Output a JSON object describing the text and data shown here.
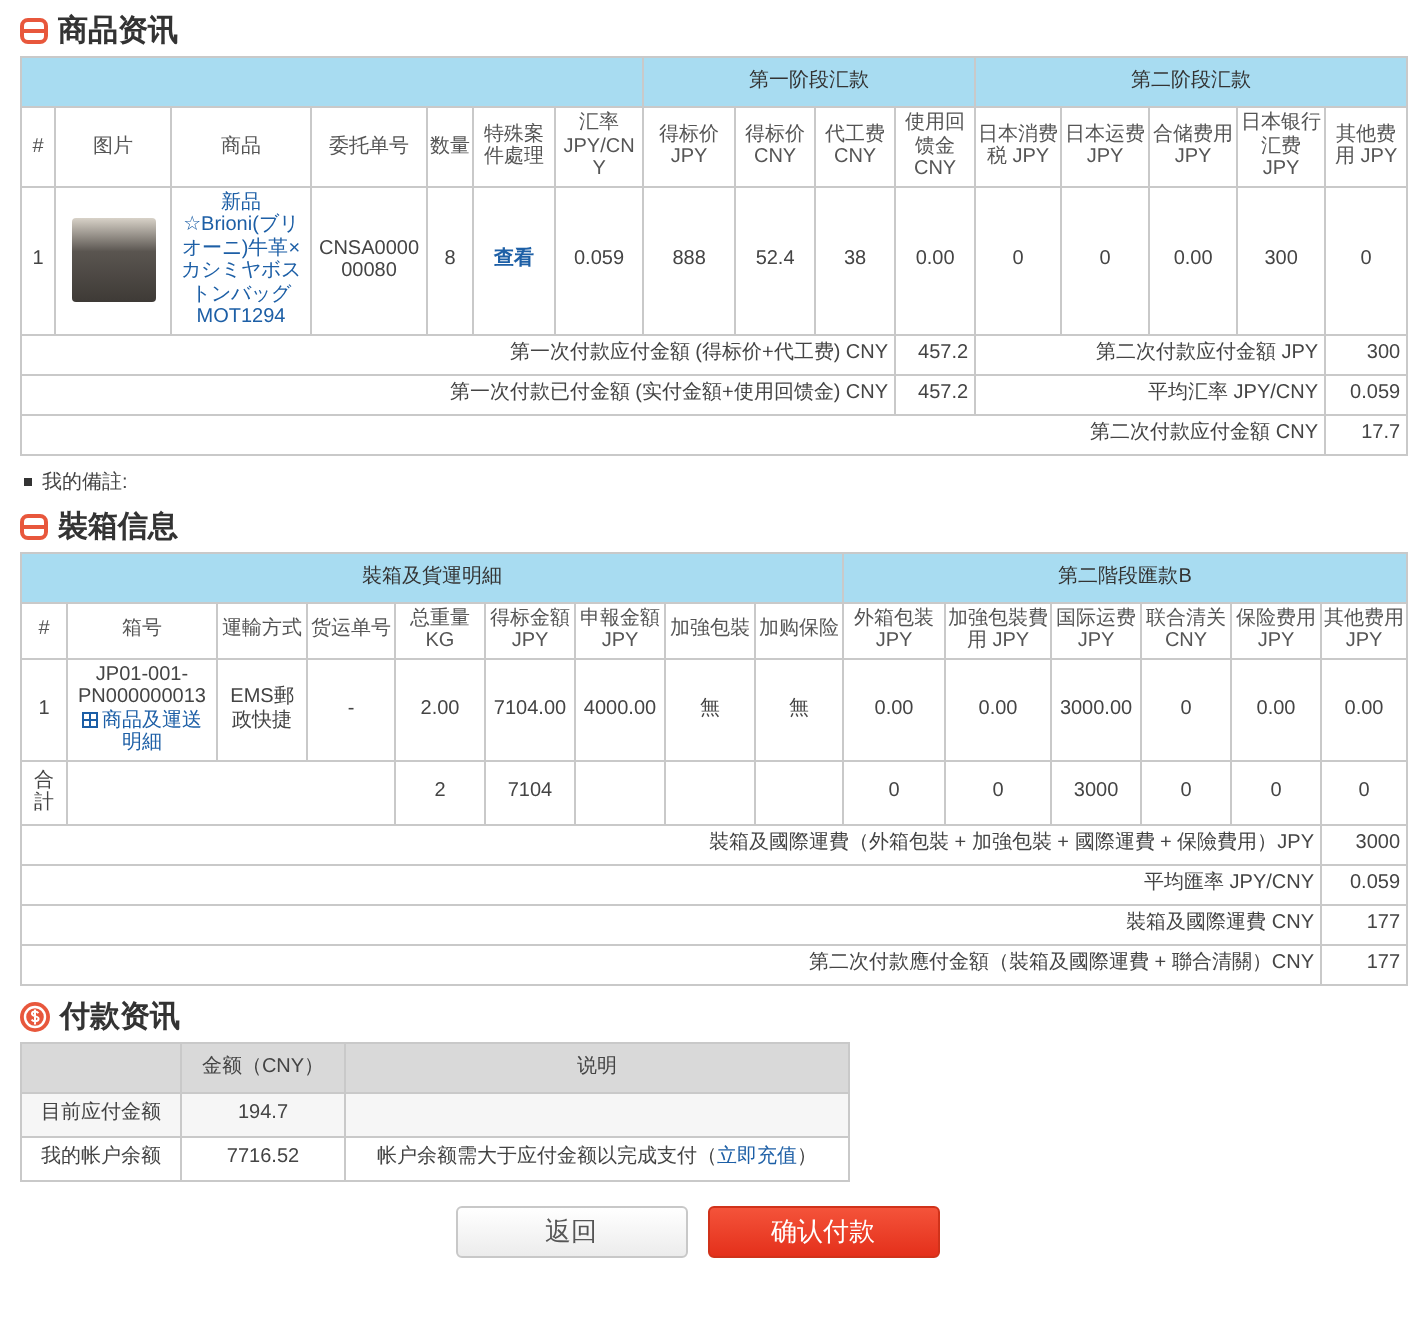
{
  "product_info": {
    "title": "商品资讯",
    "group_headers": [
      {
        "kind": "blank"
      },
      {
        "kind": "label",
        "label": "第一阶段汇款"
      },
      {
        "kind": "label",
        "label": "第二阶段汇款"
      }
    ],
    "columns": [
      "#",
      "图片",
      "商品",
      "委托单号",
      "数量",
      "特殊案件處理",
      "汇率 JPY/CNY",
      "得标价 JPY",
      "得标价 CNY",
      "代工费 CNY",
      "使用回馈金 CNY",
      "日本消费税 JPY",
      "日本运费 JPY",
      "合储费用 JPY",
      "日本银行汇费 JPY",
      "其他费用 JPY"
    ],
    "rows": [
      {
        "index": "1",
        "product": "新品☆Brioni(ブリオーニ)牛革×カシミヤボストンバッグ MOT1294",
        "order_no": "CNSA000000080",
        "quantity": "8",
        "special": "查看",
        "values": [
          "0.059",
          "888",
          "52.4",
          "38",
          "0.00",
          "0",
          "0",
          "0.00",
          "300",
          "0"
        ]
      }
    ],
    "summary": [
      {
        "cells": [
          {
            "label": "第一次付款应付金額 (得标价+代工费) CNY",
            "value": "457.2"
          },
          {
            "label": "第二次付款应付金額 JPY",
            "value": "300"
          }
        ]
      },
      {
        "cells": [
          {
            "label": "第一次付款已付金額 (实付金額+使用回馈金) CNY",
            "value": "457.2"
          },
          {
            "label": "平均汇率 JPY/CNY",
            "value": "0.059"
          }
        ]
      },
      {
        "cells": [
          {
            "label": "第二次付款应付金額 CNY",
            "value": "17.7"
          }
        ]
      }
    ]
  },
  "remark": {
    "label": "我的備註:"
  },
  "packing_info": {
    "title": "裝箱信息",
    "group_headers": [
      {
        "kind": "label",
        "label": "裝箱及貨運明細"
      },
      {
        "kind": "label",
        "label": "第二階段匯款B"
      }
    ],
    "columns": [
      "#",
      "箱号",
      "運輸方式",
      "货运单号",
      "总重量 KG",
      "得标金額 JPY",
      "申報金額 JPY",
      "加強包裝",
      "加购保险",
      "外箱包装 JPY",
      "加強包裝費用 JPY",
      "国际运费 JPY",
      "联合清关 CNY",
      "保险费用 JPY",
      "其他费用 JPY"
    ],
    "rows": [
      {
        "kind": "box",
        "index": "1",
        "box_no": "JP01-001-PN000000013",
        "detail_link": "商品及運送明細",
        "shipping": "EMS郵政快捷",
        "tracking": "-",
        "values": [
          "2.00",
          "7104.00",
          "4000.00",
          "無",
          "無",
          "0.00",
          "0.00",
          "3000.00",
          "0",
          "0.00",
          "0.00"
        ]
      },
      {
        "kind": "total",
        "label": "合計",
        "weight": "2",
        "amount": "7104",
        "fees": [
          "0",
          "0",
          "3000",
          "0",
          "0",
          "0"
        ]
      }
    ],
    "summary": [
      {
        "label": "裝箱及國際運費（外箱包裝 + 加強包裝 + 國際運費 + 保險費用）JPY",
        "value": "3000"
      },
      {
        "label": "平均匯率 JPY/CNY",
        "value": "0.059"
      },
      {
        "label": "裝箱及國際運費 CNY",
        "value": "177"
      },
      {
        "label": "第二次付款應付金額（裝箱及國際運費 + 聯合清關）CNY",
        "value": "177"
      }
    ]
  },
  "payment_info": {
    "title": "付款资讯",
    "columns": [
      "金额（CNY）",
      "说明"
    ],
    "rows": [
      {
        "label": "目前应付金额",
        "amount": "194.7"
      },
      {
        "label": "我的帐户余额",
        "amount": "7716.52",
        "note": "帐户余额需大于应付金额以完成支付（",
        "link": "立即充值",
        "note_end": "）"
      }
    ]
  },
  "buttons": [
    {
      "label": "返回",
      "kind": "secondary"
    },
    {
      "label": "确认付款",
      "kind": "primary"
    }
  ]
}
